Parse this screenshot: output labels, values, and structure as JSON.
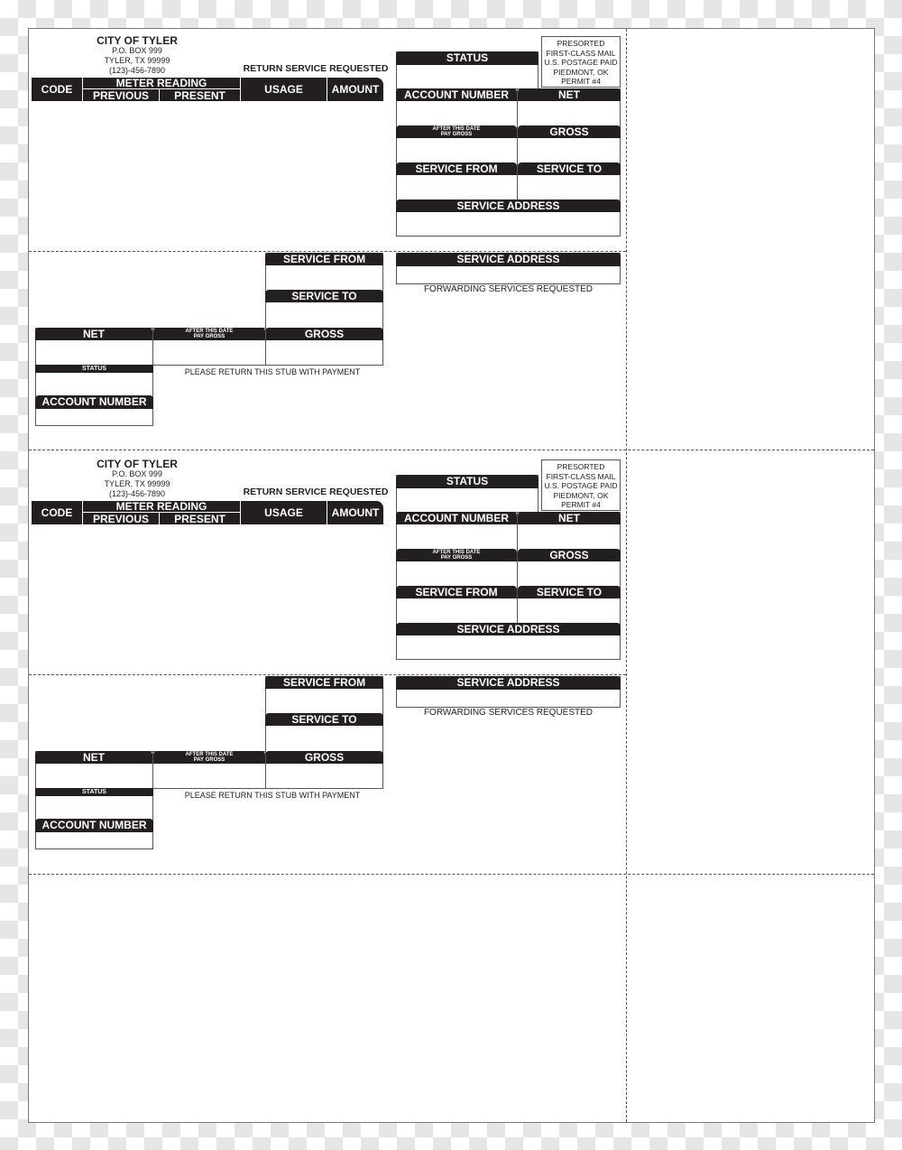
{
  "bills": [
    {
      "header": {
        "city": "CITY OF TYLER",
        "po_box": "P.O. BOX 999",
        "city_state": "TYLER, TX 99999",
        "phone": "(123)-456-7890",
        "return_service": "RETURN SERVICE REQUESTED"
      },
      "table": {
        "code": "CODE",
        "meter_reading": "METER READING",
        "previous": "PREVIOUS",
        "present": "PRESENT",
        "usage": "USAGE",
        "amount": "AMOUNT"
      },
      "postage": [
        "PRESORTED",
        "FIRST-CLASS MAIL",
        "U.S. POSTAGE PAID",
        "PIEDMONT, OK",
        "PERMIT #4"
      ],
      "fields": {
        "status": "STATUS",
        "account_number": "ACCOUNT NUMBER",
        "net": "NET",
        "after_date_1": "AFTER THIS DATE",
        "after_date_2": "PAY GROSS",
        "gross": "GROSS",
        "service_from": "SERVICE FROM",
        "service_to": "SERVICE TO",
        "service_address": "SERVICE ADDRESS"
      },
      "stub": {
        "service_from": "SERVICE FROM",
        "service_to": "SERVICE TO",
        "gross": "GROSS",
        "net": "NET",
        "after_date_1": "AFTER THIS DATE",
        "after_date_2": "PAY GROSS",
        "status": "STATUS",
        "account_number": "ACCOUNT NUMBER",
        "service_address": "SERVICE ADDRESS",
        "forwarding": "FORWARDING SERVICES REQUESTED",
        "return_stub": "PLEASE RETURN THIS STUB WITH PAYMENT"
      }
    },
    {
      "header": {
        "city": "CITY OF TYLER",
        "po_box": "P.O. BOX 999",
        "city_state": "TYLER, TX 99999",
        "phone": "(123)-456-7890",
        "return_service": "RETURN SERVICE REQUESTED"
      },
      "table": {
        "code": "CODE",
        "meter_reading": "METER READING",
        "previous": "PREVIOUS",
        "present": "PRESENT",
        "usage": "USAGE",
        "amount": "AMOUNT"
      },
      "postage": [
        "PRESORTED",
        "FIRST-CLASS MAIL",
        "U.S. POSTAGE PAID",
        "PIEDMONT, OK",
        "PERMIT #4"
      ],
      "fields": {
        "status": "STATUS",
        "account_number": "ACCOUNT NUMBER",
        "net": "NET",
        "after_date_1": "AFTER THIS DATE",
        "after_date_2": "PAY GROSS",
        "gross": "GROSS",
        "service_from": "SERVICE FROM",
        "service_to": "SERVICE TO",
        "service_address": "SERVICE ADDRESS"
      },
      "stub": {
        "service_from": "SERVICE FROM",
        "service_to": "SERVICE TO",
        "gross": "GROSS",
        "net": "NET",
        "after_date_1": "AFTER THIS DATE",
        "after_date_2": "PAY GROSS",
        "status": "STATUS",
        "account_number": "ACCOUNT NUMBER",
        "service_address": "SERVICE ADDRESS",
        "forwarding": "FORWARDING SERVICES REQUESTED",
        "return_stub": "PLEASE RETURN THIS STUB WITH PAYMENT"
      }
    }
  ]
}
